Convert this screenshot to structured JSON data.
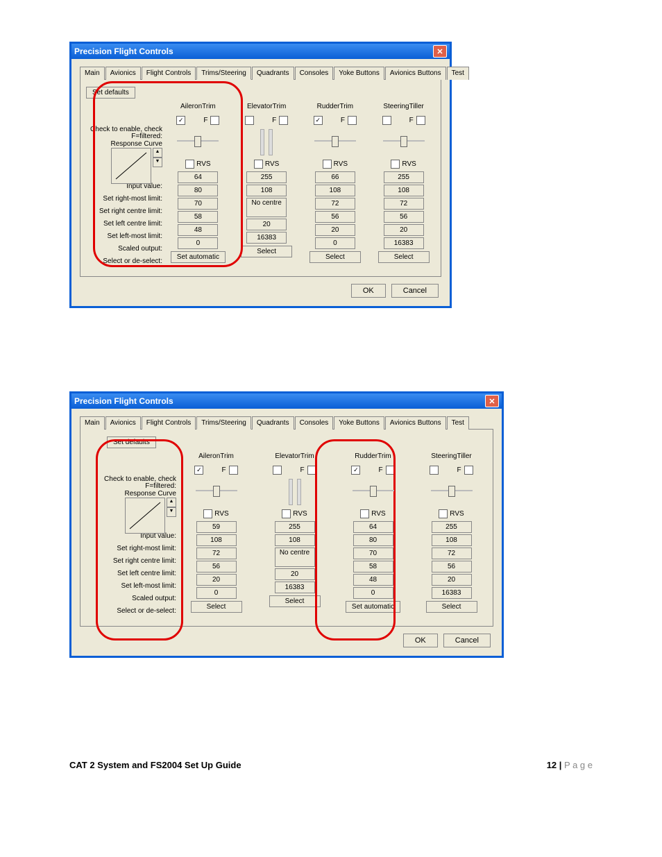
{
  "footer": {
    "title": "CAT 2 System and FS2004 Set Up Guide",
    "page_prefix": "12 | ",
    "page_suffix": "P a g e"
  },
  "win": {
    "title": "Precision Flight Controls"
  },
  "tabs": [
    "Main",
    "Avionics",
    "Flight Controls",
    "Trims/Steering",
    "Quadrants",
    "Consoles",
    "Yoke Buttons",
    "Avionics Buttons",
    "Test"
  ],
  "setdef": "Set defaults",
  "labels": {
    "check": "Check to enable, check F=filtered:",
    "curve": "Response Curve",
    "input": "Input value:",
    "rmax": "Set right-most limit:",
    "rcen": "Set right centre limit:",
    "lcen": "Set left centre limit:",
    "lmax": "Set left-most limit:",
    "scaled": "Scaled output:",
    "sel": "Select or de-select:"
  },
  "rvs": "RVS",
  "f": "F",
  "ok": "OK",
  "cancel": "Cancel",
  "d1": {
    "cols": [
      {
        "head": "AileronTrim",
        "en": true,
        "vals": [
          "64",
          "80",
          "70",
          "58",
          "48",
          "0"
        ],
        "btn": "Set automatic",
        "nocentre": false
      },
      {
        "head": "ElevatorTrim",
        "en": false,
        "vals": [
          "255",
          "108",
          "No centre",
          "",
          "20",
          "16383"
        ],
        "btn": "Select",
        "nocentre": true
      },
      {
        "head": "RudderTrim",
        "en": true,
        "vals": [
          "66",
          "108",
          "72",
          "56",
          "20",
          "0"
        ],
        "btn": "Select",
        "nocentre": false
      },
      {
        "head": "SteeringTiller",
        "en": false,
        "vals": [
          "255",
          "108",
          "72",
          "56",
          "20",
          "16383"
        ],
        "btn": "Select",
        "nocentre": false
      }
    ]
  },
  "d2": {
    "cols": [
      {
        "head": "AileronTrim",
        "en": true,
        "vals": [
          "59",
          "108",
          "72",
          "56",
          "20",
          "0"
        ],
        "btn": "Select",
        "nocentre": false
      },
      {
        "head": "ElevatorTrim",
        "en": false,
        "vals": [
          "255",
          "108",
          "No centre",
          "",
          "20",
          "16383"
        ],
        "btn": "Select",
        "nocentre": true
      },
      {
        "head": "RudderTrim",
        "en": true,
        "vals": [
          "64",
          "80",
          "70",
          "58",
          "48",
          "0"
        ],
        "btn": "Set automatic",
        "nocentre": false
      },
      {
        "head": "SteeringTiller",
        "en": false,
        "vals": [
          "255",
          "108",
          "72",
          "56",
          "20",
          "16383"
        ],
        "btn": "Select",
        "nocentre": false
      }
    ]
  }
}
